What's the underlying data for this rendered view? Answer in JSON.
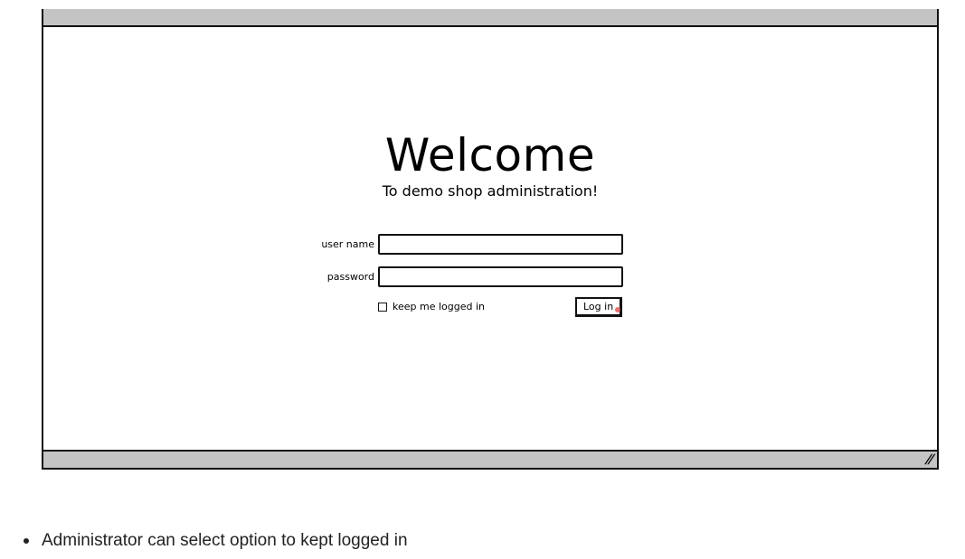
{
  "login": {
    "title": "Welcome",
    "subtitle": "To demo shop administration!",
    "username_label": "user name",
    "username_value": "",
    "password_label": "password",
    "password_value": "",
    "remember_label": "keep me logged in",
    "remember_checked": false,
    "login_button": "Log in"
  },
  "window": {
    "resize_icon": "resize-grip-icon"
  },
  "notes": [
    "Administrator can select option to kept logged in"
  ]
}
